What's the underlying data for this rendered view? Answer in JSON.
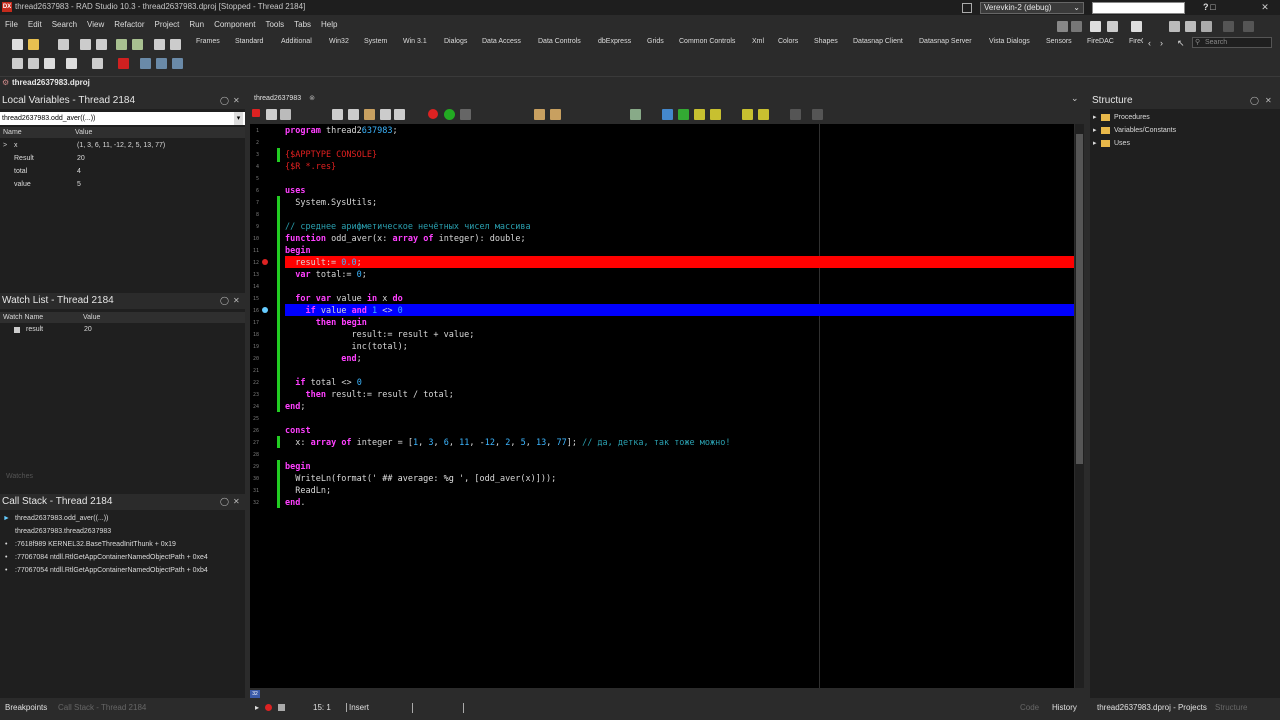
{
  "window": {
    "title": "thread2637983 - RAD Studio 10.3 - thread2637983.dproj [Stopped - Thread 2184]",
    "app_icon": "delphi-logo",
    "profile": "Verevkin-2  (debug)",
    "help_label": "?"
  },
  "menu": [
    "File",
    "Edit",
    "Search",
    "View",
    "Refactor",
    "Project",
    "Run",
    "Component",
    "Tools",
    "Tabs",
    "Help"
  ],
  "palette_tabs": [
    "Frames",
    "Standard",
    "Additional",
    "Win32",
    "System",
    "Win 3.1",
    "Dialogs",
    "Data Access",
    "Data Controls",
    "dbExpress",
    "Grids",
    "Common Controls",
    "Xml",
    "Colors",
    "Shapes",
    "Datasnap Client",
    "Datasnap Server",
    "Vista Dialogs",
    "Sensors",
    "FireDAC",
    "FireC"
  ],
  "search_placeholder": "Search",
  "project_file": "thread2637983.dproj",
  "local_vars": {
    "title": "Local Variables - Thread 2184",
    "context": "thread2637983.odd_aver((...))",
    "col_name": "Name",
    "col_value": "Value",
    "rows": [
      {
        "name": "x",
        "value": "(1, 3, 6, 11, -12, 2, 5, 13, 77)",
        "expandable": ">"
      },
      {
        "name": "Result",
        "value": "20"
      },
      {
        "name": "total",
        "value": "4"
      },
      {
        "name": "value",
        "value": "5"
      }
    ]
  },
  "watch_list": {
    "title": "Watch List - Thread 2184",
    "col_name": "Watch Name",
    "col_value": "Value",
    "rows": [
      {
        "name": "result",
        "value": "20"
      }
    ],
    "tab": "Watches"
  },
  "call_stack": {
    "title": "Call Stack - Thread 2184",
    "rows": [
      "thread2637983.odd_aver((...))",
      "thread2637983.thread2637983",
      ":7618f989 KERNEL32.BaseThreadInitThunk + 0x19",
      ":77067084 ntdll.RtlGetAppContainerNamedObjectPath + 0xe4",
      ":77067054 ntdll.RtlGetAppContainerNamedObjectPath + 0xb4"
    ]
  },
  "editor": {
    "tab": "thread2637983",
    "close_label": "⊗",
    "lines": [
      {
        "n": "1",
        "t": "program thread2637983;"
      },
      {
        "n": "2",
        "t": ""
      },
      {
        "n": "3",
        "t": "{$APPTYPE CONSOLE}"
      },
      {
        "n": "4",
        "t": "{$R *.res}"
      },
      {
        "n": "5",
        "t": ""
      },
      {
        "n": "6",
        "t": "uses"
      },
      {
        "n": "7",
        "t": "  System.SysUtils;"
      },
      {
        "n": "8",
        "t": ""
      },
      {
        "n": "9",
        "t": "// среднее арифметическое нечётных чисел массива"
      },
      {
        "n": "10",
        "t": "function odd_aver(x: array of integer): double;"
      },
      {
        "n": "11",
        "t": "begin"
      },
      {
        "n": "12",
        "t": "  result:= 0.0;"
      },
      {
        "n": "13",
        "t": "  var total:= 0;"
      },
      {
        "n": "14",
        "t": ""
      },
      {
        "n": "15",
        "t": "  for var value in x do"
      },
      {
        "n": "16",
        "t": "    if value and 1 <> 0"
      },
      {
        "n": "17",
        "t": "      then begin"
      },
      {
        "n": "18",
        "t": "             result:= result + value;"
      },
      {
        "n": "19",
        "t": "             inc(total);"
      },
      {
        "n": "20",
        "t": "           end;"
      },
      {
        "n": "21",
        "t": ""
      },
      {
        "n": "22",
        "t": "  if total <> 0"
      },
      {
        "n": "23",
        "t": "    then result:= result / total;"
      },
      {
        "n": "24",
        "t": "end;"
      },
      {
        "n": "25",
        "t": ""
      },
      {
        "n": "26",
        "t": "const"
      },
      {
        "n": "27",
        "t": "  x: array of integer = [1, 3, 6, 11, -12, 2, 5, 13, 77]; // да, детка, так тоже можно!"
      },
      {
        "n": "28",
        "t": ""
      },
      {
        "n": "29",
        "t": "begin"
      },
      {
        "n": "30",
        "t": "  WriteLn(format(' ## average: %g ', [odd_aver(x)]));"
      },
      {
        "n": "31",
        "t": "  ReadLn;"
      },
      {
        "n": "32",
        "t": "end."
      }
    ],
    "breakpoint_line": 12,
    "exec_line": 16,
    "cursor_line_label": "32"
  },
  "structure": {
    "title": "Structure",
    "items": [
      "Procedures",
      "Variables/Constants",
      "Uses"
    ]
  },
  "status": {
    "left_tabs": [
      "Breakpoints",
      "Call Stack - Thread 2184"
    ],
    "position": "15:  1",
    "mode": "Insert",
    "view_tabs": [
      "Code",
      "History"
    ],
    "right_tabs": [
      "thread2637983.dproj - Projects",
      "Structure"
    ]
  },
  "colors": {
    "breakpoint": "#ff0000",
    "exec_point": "#0000ff",
    "editor_bg": "#000000"
  }
}
